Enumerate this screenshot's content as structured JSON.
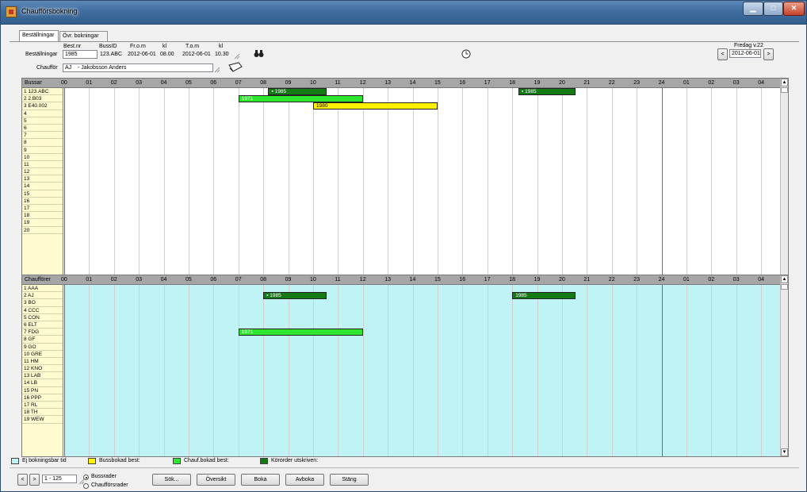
{
  "window": {
    "title": "Chaufförsbokning",
    "min": "▁",
    "max": "□",
    "close": "✕"
  },
  "tabs": [
    {
      "label": "Beställningar",
      "ul": "B"
    },
    {
      "label": "Övr. bokningar"
    }
  ],
  "form": {
    "col_best_nr": "Best.nr",
    "col_buss_id": "BussID",
    "col_from": "Fr.o.m",
    "col_kl1": "kl",
    "col_tom": "T.o.m",
    "col_kl2": "kl",
    "row_label": "Beställningar",
    "best_nr": "1985",
    "buss_id": "123.ABC",
    "from_date": "2012-06-01",
    "from_time": "08.00",
    "to_date": "2012-06-01",
    "to_time": "10.30",
    "chauffor_label": "Chaufför",
    "chauffor_code": "AJ",
    "chauffor_name": "- Jakobsson Anders",
    "day_label": "Fredag  v.22",
    "date": "2012-06-01",
    "prev": "<",
    "next": ">"
  },
  "hours": [
    "00",
    "01",
    "02",
    "03",
    "04",
    "05",
    "06",
    "07",
    "08",
    "09",
    "10",
    "11",
    "12",
    "13",
    "14",
    "15",
    "16",
    "17",
    "18",
    "19",
    "20",
    "21",
    "22",
    "23",
    "24",
    "01",
    "02",
    "03",
    "04"
  ],
  "bus_panel": {
    "header": "Bussar",
    "rows": [
      "1    123.ABC",
      "2    2.B03",
      "3    E40.002",
      "4",
      "5",
      "6",
      "7",
      "8",
      "9",
      "10",
      "11",
      "12",
      "13",
      "14",
      "15",
      "16",
      "17",
      "18",
      "19",
      "20"
    ],
    "bars": [
      {
        "row": 0,
        "start": 8.2,
        "end": 10.55,
        "label": "1985",
        "style": "dark",
        "icon": true
      },
      {
        "row": 0,
        "start": 18.25,
        "end": 20.55,
        "label": "1985",
        "style": "dark",
        "icon": true
      },
      {
        "row": 1,
        "start": 7.0,
        "end": 12.0,
        "label": "1971",
        "style": "green"
      },
      {
        "row": 2,
        "start": 10.0,
        "end": 15.0,
        "label": "1980",
        "style": "yellow"
      }
    ]
  },
  "driver_panel": {
    "header": "Chaufförer",
    "rows": [
      "1    AAA",
      "2    AJ",
      "3    BO",
      "4    CCC",
      "5    CON",
      "6    ELT",
      "7    FDG",
      "8    GF",
      "9    GO",
      "10  GRE",
      "11  HM",
      "12  KNO",
      "13  LAB",
      "14  LB",
      "15  PN",
      "16  PPP",
      "17  RL",
      "18  TH",
      "19  WEW"
    ],
    "bars": [
      {
        "row": 1,
        "start": 8.0,
        "end": 10.55,
        "label": "1985",
        "style": "dark",
        "icon": true
      },
      {
        "row": 1,
        "start": 18.0,
        "end": 20.55,
        "label": "1985",
        "style": "dark"
      },
      {
        "row": 6,
        "start": 7.0,
        "end": 12.0,
        "label": "1971",
        "style": "green"
      }
    ]
  },
  "legend": [
    {
      "label": "Ej bokningsbar tid",
      "color": "#bff3f6"
    },
    {
      "label": "Bussbokad best:",
      "color": "#fff000"
    },
    {
      "label": "Chauf.bokad best:",
      "color": "#2ee62e"
    },
    {
      "label": "Körorder utskriven:",
      "color": "#157a15"
    }
  ],
  "footer": {
    "prev": "<",
    "next": ">",
    "range": "1  - 125",
    "radio_bus": "Bussrader",
    "radio_driver": "Chaufförsrader",
    "btn_sok": "Sök...",
    "btn_oversikt": "Översikt",
    "btn_boka": "Boka",
    "btn_avboka": "Avboka",
    "btn_stang": "Stäng"
  },
  "colors": {
    "unbookable": "#bff3f6",
    "bus_rows_bg": "#fffbd0",
    "header_gray": "#a6a6a6",
    "now_line": "#e04040"
  }
}
